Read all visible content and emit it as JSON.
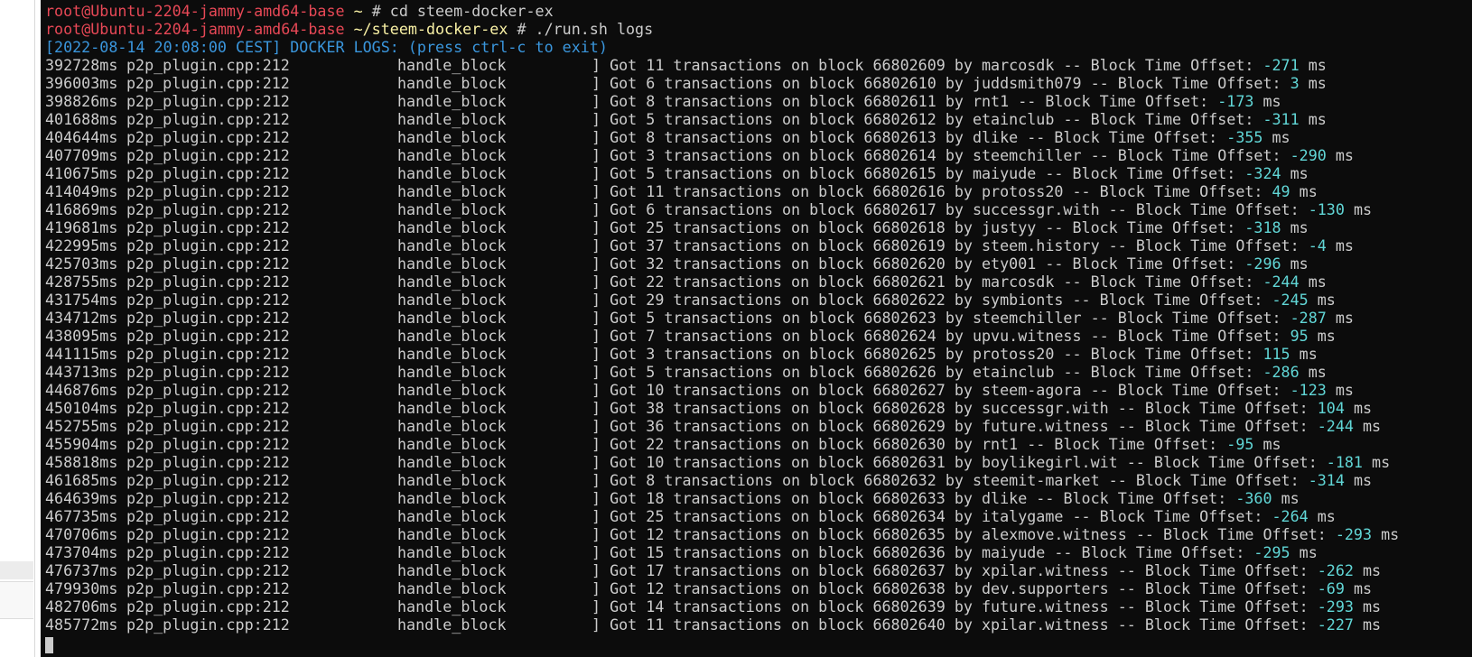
{
  "prompt": {
    "user": "root",
    "host": "Ubuntu-2204-jammy-amd64-base",
    "symbol": "#"
  },
  "commands": [
    {
      "path": "~",
      "cmd": "cd steem-docker-ex"
    },
    {
      "path": "~/steem-docker-ex",
      "cmd": "./run.sh logs"
    }
  ],
  "banner": "[2022-08-14 20:08:00 CEST] DOCKER LOGS: (press ctrl-c to exit)",
  "log_file": "p2p_plugin.cpp:212",
  "log_func": "handle_block",
  "log_bracket": "]",
  "log_words": {
    "got": "Got",
    "tx": "transactions on block",
    "by": "by",
    "sep": "--",
    "offset": "Block Time Offset:",
    "unit": "ms"
  },
  "logs": [
    {
      "ms": "392728ms",
      "count": "11",
      "block": "66802609",
      "witness": "marcosdk",
      "offset": "-271"
    },
    {
      "ms": "396003ms",
      "count": "6",
      "block": "66802610",
      "witness": "juddsmith079",
      "offset": "3"
    },
    {
      "ms": "398826ms",
      "count": "8",
      "block": "66802611",
      "witness": "rnt1",
      "offset": "-173"
    },
    {
      "ms": "401688ms",
      "count": "5",
      "block": "66802612",
      "witness": "etainclub",
      "offset": "-311"
    },
    {
      "ms": "404644ms",
      "count": "8",
      "block": "66802613",
      "witness": "dlike",
      "offset": "-355"
    },
    {
      "ms": "407709ms",
      "count": "3",
      "block": "66802614",
      "witness": "steemchiller",
      "offset": "-290"
    },
    {
      "ms": "410675ms",
      "count": "5",
      "block": "66802615",
      "witness": "maiyude",
      "offset": "-324"
    },
    {
      "ms": "414049ms",
      "count": "11",
      "block": "66802616",
      "witness": "protoss20",
      "offset": "49"
    },
    {
      "ms": "416869ms",
      "count": "6",
      "block": "66802617",
      "witness": "successgr.with",
      "offset": "-130"
    },
    {
      "ms": "419681ms",
      "count": "25",
      "block": "66802618",
      "witness": "justyy",
      "offset": "-318"
    },
    {
      "ms": "422995ms",
      "count": "37",
      "block": "66802619",
      "witness": "steem.history",
      "offset": "-4"
    },
    {
      "ms": "425703ms",
      "count": "32",
      "block": "66802620",
      "witness": "ety001",
      "offset": "-296"
    },
    {
      "ms": "428755ms",
      "count": "22",
      "block": "66802621",
      "witness": "marcosdk",
      "offset": "-244"
    },
    {
      "ms": "431754ms",
      "count": "29",
      "block": "66802622",
      "witness": "symbionts",
      "offset": "-245"
    },
    {
      "ms": "434712ms",
      "count": "5",
      "block": "66802623",
      "witness": "steemchiller",
      "offset": "-287"
    },
    {
      "ms": "438095ms",
      "count": "7",
      "block": "66802624",
      "witness": "upvu.witness",
      "offset": "95"
    },
    {
      "ms": "441115ms",
      "count": "3",
      "block": "66802625",
      "witness": "protoss20",
      "offset": "115"
    },
    {
      "ms": "443713ms",
      "count": "5",
      "block": "66802626",
      "witness": "etainclub",
      "offset": "-286"
    },
    {
      "ms": "446876ms",
      "count": "10",
      "block": "66802627",
      "witness": "steem-agora",
      "offset": "-123"
    },
    {
      "ms": "450104ms",
      "count": "38",
      "block": "66802628",
      "witness": "successgr.with",
      "offset": "104"
    },
    {
      "ms": "452755ms",
      "count": "36",
      "block": "66802629",
      "witness": "future.witness",
      "offset": "-244"
    },
    {
      "ms": "455904ms",
      "count": "22",
      "block": "66802630",
      "witness": "rnt1",
      "offset": "-95"
    },
    {
      "ms": "458818ms",
      "count": "10",
      "block": "66802631",
      "witness": "boylikegirl.wit",
      "offset": "-181"
    },
    {
      "ms": "461685ms",
      "count": "8",
      "block": "66802632",
      "witness": "steemit-market",
      "offset": "-314"
    },
    {
      "ms": "464639ms",
      "count": "18",
      "block": "66802633",
      "witness": "dlike",
      "offset": "-360"
    },
    {
      "ms": "467735ms",
      "count": "25",
      "block": "66802634",
      "witness": "italygame",
      "offset": "-264"
    },
    {
      "ms": "470706ms",
      "count": "12",
      "block": "66802635",
      "witness": "alexmove.witness",
      "offset": "-293"
    },
    {
      "ms": "473704ms",
      "count": "15",
      "block": "66802636",
      "witness": "maiyude",
      "offset": "-295"
    },
    {
      "ms": "476737ms",
      "count": "17",
      "block": "66802637",
      "witness": "xpilar.witness",
      "offset": "-262"
    },
    {
      "ms": "479930ms",
      "count": "12",
      "block": "66802638",
      "witness": "dev.supporters",
      "offset": "-69"
    },
    {
      "ms": "482706ms",
      "count": "14",
      "block": "66802639",
      "witness": "future.witness",
      "offset": "-293"
    },
    {
      "ms": "485772ms",
      "count": "11",
      "block": "66802640",
      "witness": "xpilar.witness",
      "offset": "-227"
    }
  ],
  "colors": {
    "background": "#0c0c0c",
    "text": "#cccccc",
    "prompt_user": "#e74856",
    "prompt_path": "#f9f1a5",
    "banner": "#3a96dd",
    "numbers": "#61d6d6"
  }
}
